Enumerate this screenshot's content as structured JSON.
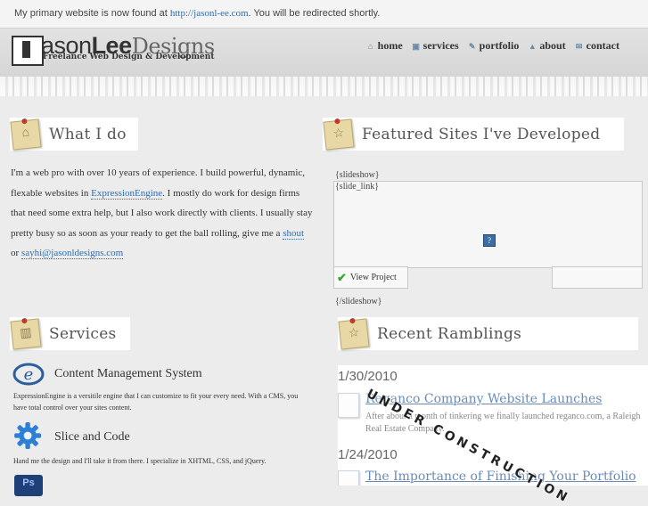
{
  "notice": {
    "text_before": "My primary website is now found at",
    "link": "http://jasonl-ee.com",
    "text_after": ". You will be redirected shortly."
  },
  "logo": {
    "jason": "ason",
    "lee": "Lee",
    "designs": "Designs",
    "tagline": "Freelance Web Design & Development"
  },
  "nav": [
    {
      "label": "home",
      "icon": "home-icon"
    },
    {
      "label": "services",
      "icon": "services-icon"
    },
    {
      "label": "portfolio",
      "icon": "portfolio-icon"
    },
    {
      "label": "about",
      "icon": "about-icon"
    },
    {
      "label": "contact",
      "icon": "contact-icon"
    }
  ],
  "sections": {
    "what_i_do": "What I do",
    "featured": "Featured Sites I've Developed",
    "services": "Services",
    "ramblings": "Recent Ramblings"
  },
  "about": {
    "text1": "I'm a web pro with over 10 years of experience.  I build powerful, dynamic, flexable websites in ",
    "ee_link": "ExpressionEngine",
    "text2": ".  I mostly do work for design firms that need some extra help, but I also work directly with clients.  I usually stay pretty busy so as soon as your ready to get the ball rolling, give me a ",
    "shout_link": "shout",
    "text3": " or ",
    "email_link": "sayhi@jasonldesigns.com"
  },
  "featured": {
    "slideshow_open": "{slideshow}",
    "slide_link": "{slide_link}",
    "view_project": "View Project",
    "slideshow_close": "{/slideshow}",
    "broken_image": "?"
  },
  "services": [
    {
      "title": "Content Management System",
      "desc": "ExpressionEngine is a versitile engine that I can customize to fit your every need. With a CMS, you have total control over your sites content.",
      "icon": "expressionengine-icon"
    },
    {
      "title": "Slice and Code",
      "desc": "Hand me the design and I'll take it from there. I specialize in XHTML, CSS, and jQuery.",
      "icon": "gear-icon"
    },
    {
      "title": "",
      "desc": "",
      "icon": "photoshop-icon",
      "icon_text": "Ps"
    }
  ],
  "ramblings": [
    {
      "date": "1/30/2010",
      "title": "Reganco Company Website Launches",
      "excerpt": "After about a month of tinkering we finally launched reganco.com, a Raleigh Real Estate Company."
    },
    {
      "date": "1/24/2010",
      "title": "The Importance of Finishing Your Portfolio",
      "excerpt": ""
    }
  ],
  "construction": "UNDER CONSTRUCTION",
  "colors": {
    "link": "#2a6db5",
    "ramble_title": "#6a8bb5",
    "check": "#3aa636"
  }
}
